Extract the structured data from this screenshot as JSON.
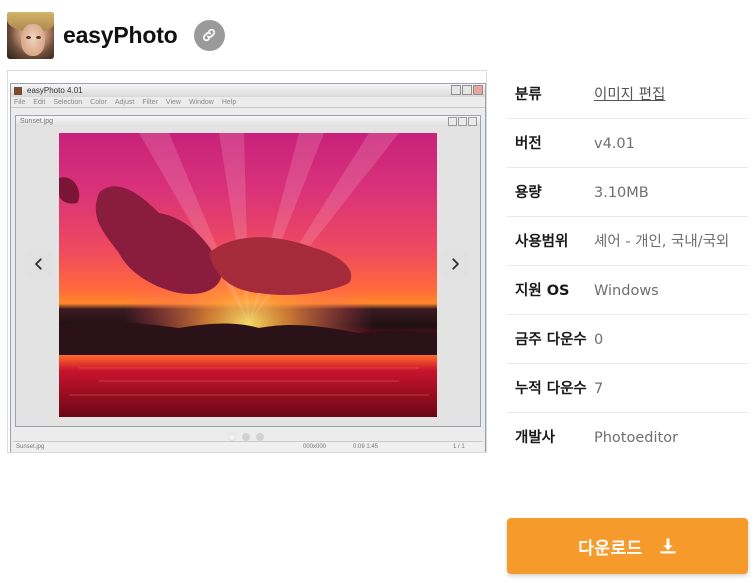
{
  "app": {
    "name": "easyPhoto",
    "icon": "app-portrait-icon",
    "link_icon": "link-icon"
  },
  "gallery": {
    "window_title": "easyPhoto 4.01",
    "menu": [
      "File",
      "Edit",
      "Selection",
      "Color",
      "Adjust",
      "Filter",
      "View",
      "Window",
      "Help"
    ],
    "document_title": "Sunset.jpg",
    "status_filename": "Sunset.jpg",
    "status_size": "000x000",
    "status_time": "0:09 1:45",
    "status_page": "1 / 1",
    "slide_count": 3,
    "active_slide": 1,
    "prev_icon": "chevron-left-icon",
    "next_icon": "chevron-right-icon"
  },
  "info": {
    "category_label": "분류",
    "category_value": "이미지 편집",
    "version_label": "버전",
    "version_value": "v4.01",
    "size_label": "용량",
    "size_value": "3.10MB",
    "license_label": "사용범위",
    "license_value": "셰어 - 개인, 국내/국외",
    "os_label": "지원 OS",
    "os_value": "Windows",
    "weekly_label": "금주 다운수",
    "weekly_value": "0",
    "total_label": "누적 다운수",
    "total_value": "7",
    "developer_label": "개발사",
    "developer_value": "Photoeditor"
  },
  "download": {
    "label": "다운로드",
    "icon": "download-icon",
    "color": "#f79a2c"
  }
}
